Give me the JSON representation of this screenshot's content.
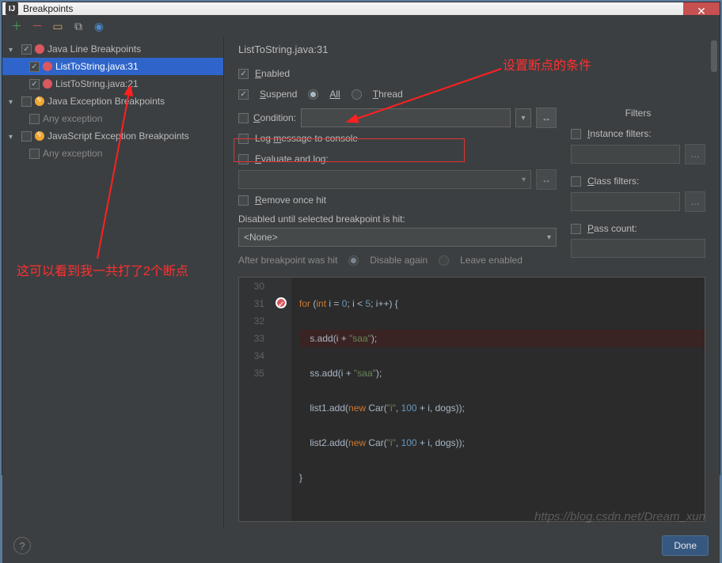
{
  "titlebar": {
    "title": "Breakpoints",
    "close": "✕"
  },
  "tree": {
    "g1": {
      "label": "Java Line Breakpoints"
    },
    "g1_items": [
      {
        "label": "ListToString.java:31"
      },
      {
        "label": "ListToString.java:21"
      }
    ],
    "g2": {
      "label": "Java Exception Breakpoints"
    },
    "g2_items": [
      {
        "label": "Any exception"
      }
    ],
    "g3": {
      "label": "JavaScript Exception Breakpoints"
    },
    "g3_items": [
      {
        "label": "Any exception"
      }
    ]
  },
  "detail": {
    "title": "ListToString.java:31",
    "enabled": "Enabled",
    "suspend": "Suspend",
    "all": "All",
    "thread": "Thread",
    "condition": "Condition:",
    "logmsg": "Log message to console",
    "evalLog": "Evaluate and log:",
    "removeOnce": "Remove once hit",
    "disabledUntil": "Disabled until selected breakpoint is hit:",
    "none": "<None>",
    "afterHit": "After breakpoint was hit",
    "disableAgain": "Disable again",
    "leaveEnabled": "Leave enabled",
    "filters": "Filters",
    "instFilters": "Instance filters:",
    "classFilters": "Class filters:",
    "passCount": "Pass count:"
  },
  "code": {
    "lines": [
      "30",
      "31",
      "32",
      "33",
      "34",
      "35"
    ],
    "l30": "            for (int i = 0; i < 5; i++) {",
    "l31": "                s.add(i + \"saa\");",
    "l32": "                ss.add(i + \"saa\");",
    "l33": "                list1.add(new Car(\"i\", 100 + i, dogs));",
    "l34": "                list2.add(new Car(\"i\", 100 + i, dogs));",
    "l35": "            }"
  },
  "footer": {
    "done": "Done"
  },
  "annot": {
    "right": "设置断点的条件",
    "left": "这可以看到我一共打了2个断点"
  },
  "watermark": "https://blog.csdn.net/Dream_xun"
}
